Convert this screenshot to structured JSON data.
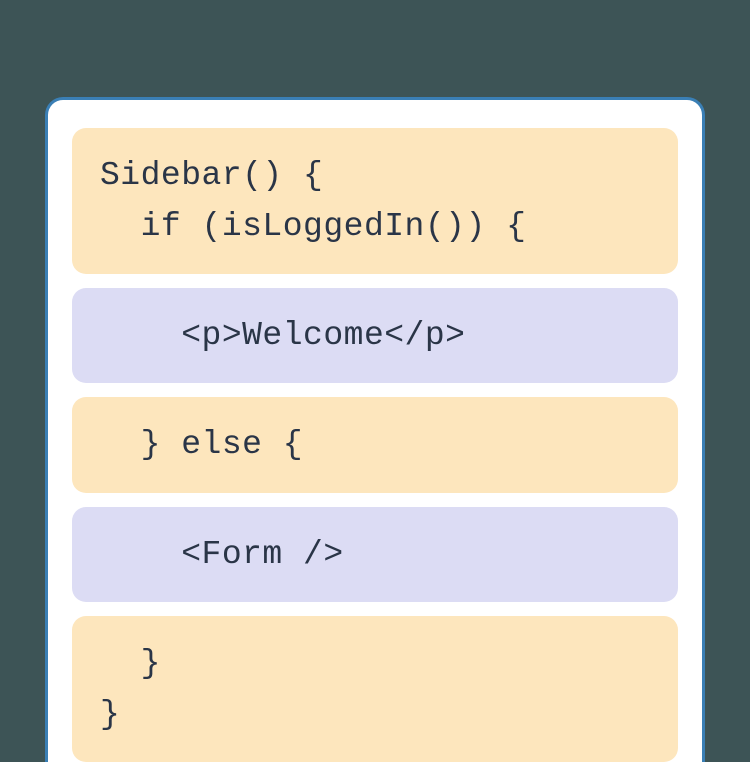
{
  "blocks": [
    {
      "type": "js",
      "text": "Sidebar() {\n  if (isLoggedIn()) {"
    },
    {
      "type": "jsx",
      "text": "    <p>Welcome</p>"
    },
    {
      "type": "js",
      "text": "  } else {"
    },
    {
      "type": "jsx",
      "text": "    <Form />"
    },
    {
      "type": "js",
      "text": "  }\n}"
    }
  ]
}
